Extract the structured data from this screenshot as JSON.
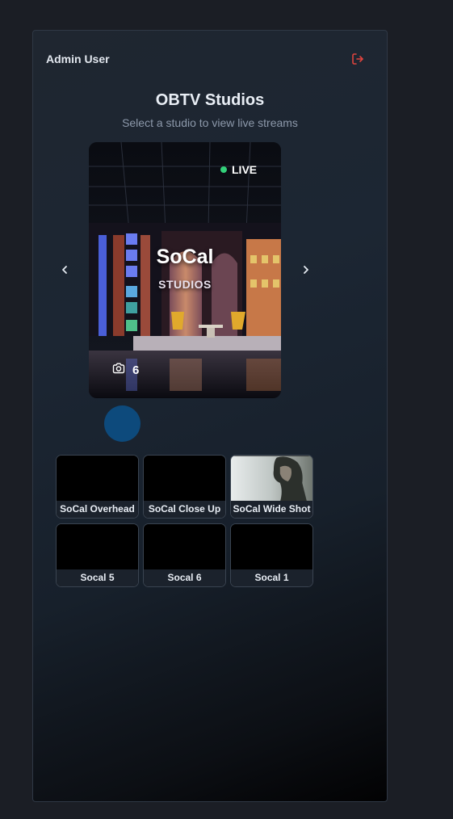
{
  "header": {
    "user_name": "Admin User",
    "logout_icon": "logout-icon",
    "logout_color": "#e0443e"
  },
  "page": {
    "title": "OBTV Studios",
    "subtitle": "Select a studio to view live streams"
  },
  "carousel": {
    "prev_icon": "chevron-left-icon",
    "next_icon": "chevron-right-icon",
    "studio": {
      "name": "SoCal",
      "sub": "STUDIOS",
      "status": "LIVE",
      "status_color": "#33d17a",
      "camera_count": "6",
      "camera_icon": "camera-icon"
    },
    "active_indicator_color": "#0d4a7c"
  },
  "cameras": [
    {
      "label": "SoCal Overhead",
      "preview": "black"
    },
    {
      "label": "SoCal Close Up",
      "preview": "black"
    },
    {
      "label": "SoCal Wide Shot",
      "preview": "image"
    },
    {
      "label": "Socal 5",
      "preview": "black"
    },
    {
      "label": "Socal 6",
      "preview": "black"
    },
    {
      "label": "Socal 1",
      "preview": "black"
    }
  ]
}
